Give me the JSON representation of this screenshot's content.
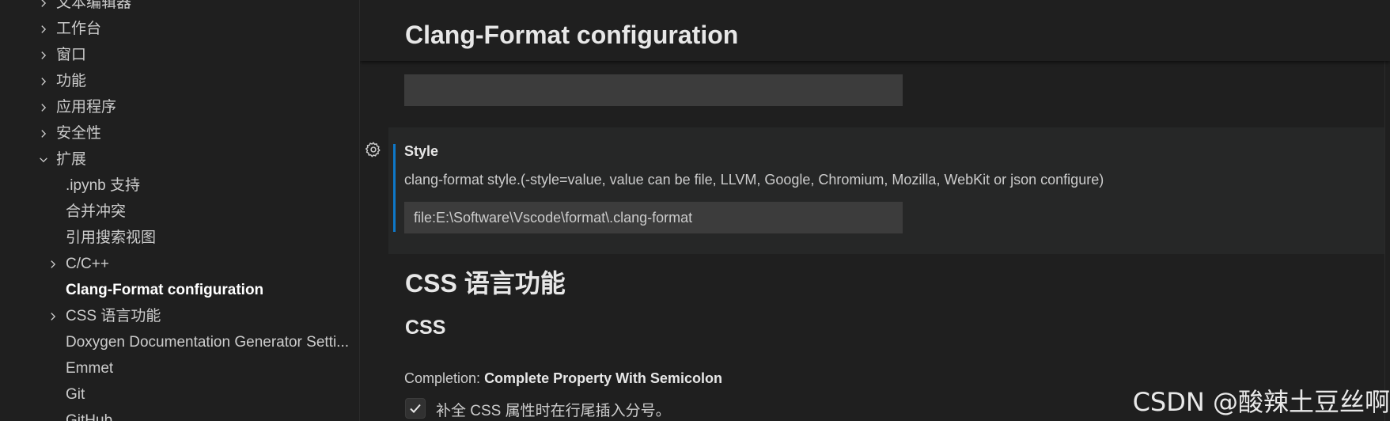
{
  "tree": {
    "items": [
      {
        "label": "文本编辑器",
        "level": 0,
        "chevron": "right"
      },
      {
        "label": "工作台",
        "level": 0,
        "chevron": "right"
      },
      {
        "label": "窗口",
        "level": 0,
        "chevron": "right"
      },
      {
        "label": "功能",
        "level": 0,
        "chevron": "right"
      },
      {
        "label": "应用程序",
        "level": 0,
        "chevron": "right"
      },
      {
        "label": "安全性",
        "level": 0,
        "chevron": "right"
      },
      {
        "label": "扩展",
        "level": 0,
        "chevron": "down"
      },
      {
        "label": ".ipynb 支持",
        "level": 1,
        "chevron": ""
      },
      {
        "label": "合并冲突",
        "level": 1,
        "chevron": ""
      },
      {
        "label": "引用搜索视图",
        "level": 1,
        "chevron": ""
      },
      {
        "label": "C/C++",
        "level": 1,
        "chevron": "right"
      },
      {
        "label": "Clang-Format configuration",
        "level": 1,
        "chevron": "",
        "active": true
      },
      {
        "label": "CSS 语言功能",
        "level": 1,
        "chevron": "right"
      },
      {
        "label": "Doxygen Documentation Generator Setti...",
        "level": 1,
        "chevron": ""
      },
      {
        "label": "Emmet",
        "level": 1,
        "chevron": ""
      },
      {
        "label": "Git",
        "level": 1,
        "chevron": ""
      },
      {
        "label": "GitHub",
        "level": 1,
        "chevron": ""
      }
    ]
  },
  "main": {
    "sticky_title": "Clang-Format configuration",
    "empty_input_value": "",
    "style_setting": {
      "title": "Style",
      "description": "clang-format style.(-style=value, value can be file, LLVM, Google, Chromium, Mozilla, WebKit or json configure)",
      "value": "file:E:\\Software\\Vscode\\format\\.clang-format",
      "icon": "gear-icon"
    },
    "section_heading": "CSS 语言功能",
    "subsection_heading": "CSS",
    "completion_setting": {
      "category": "Completion: ",
      "title": "Complete Property With Semicolon",
      "checkbox_label": "补全 CSS 属性时在行尾插入分号。",
      "checked": true
    }
  },
  "watermark": "CSDN @酸辣土豆丝啊",
  "colors": {
    "background": "#1f1f1f",
    "focus_background": "#262727",
    "focus_bar": "#0e78c9",
    "input_background": "#3c3c3c",
    "text": "#cccccc",
    "heading_text": "#e7e7e7"
  }
}
